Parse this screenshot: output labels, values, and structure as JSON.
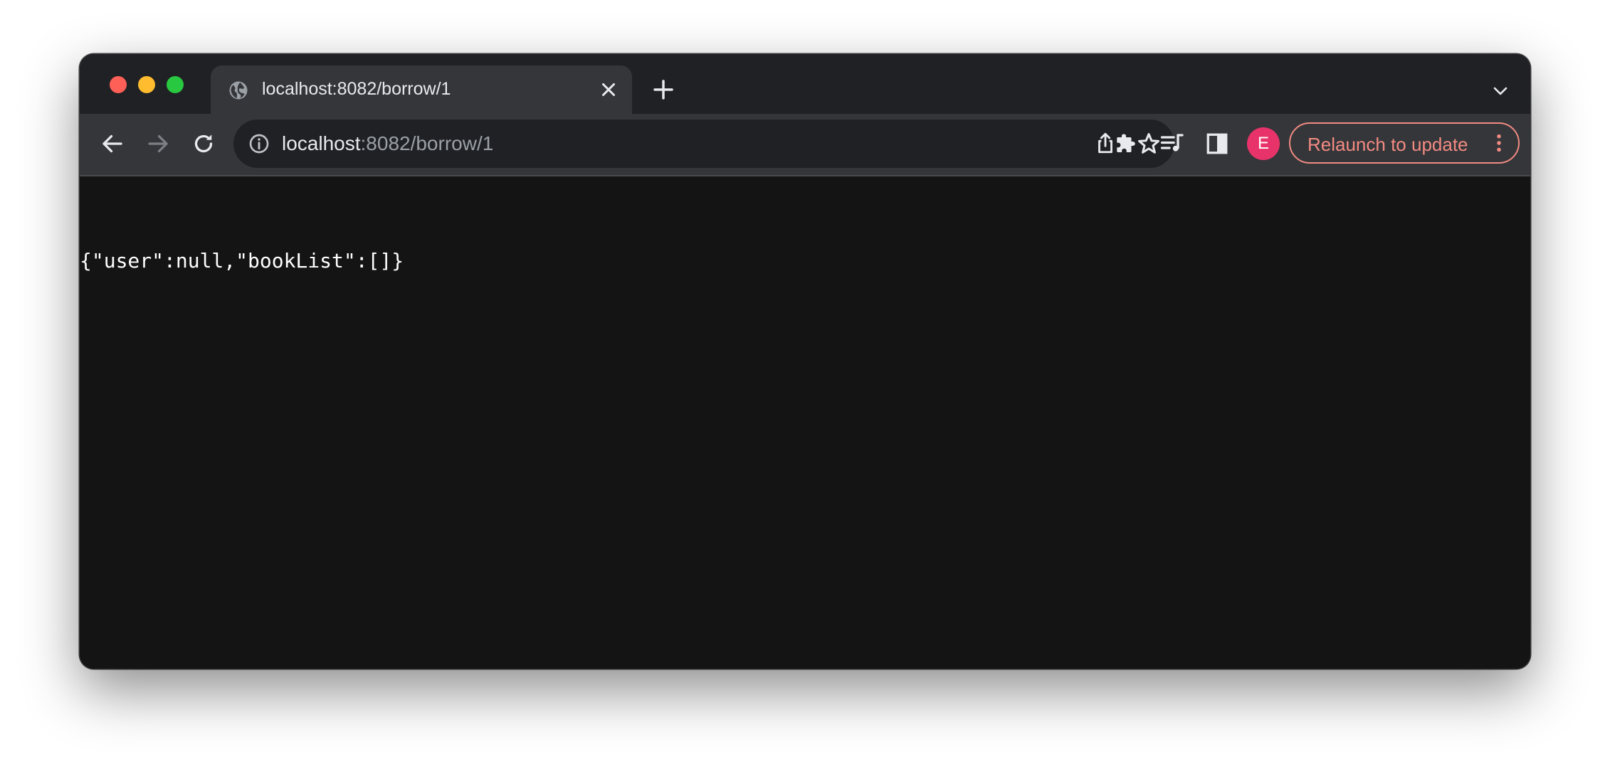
{
  "browser": {
    "tab": {
      "title": "localhost:8082/borrow/1",
      "favicon": "globe-icon"
    },
    "address_bar": {
      "host": "localhost",
      "path": ":8082/borrow/1"
    },
    "profile_initial": "E",
    "relaunch_label": "Relaunch to update",
    "colors": {
      "close": "#fe5f57",
      "minimize": "#febc2e",
      "maximize": "#28c840",
      "avatar": "#e8336a",
      "relaunch_accent": "#f28b82"
    },
    "icons": {
      "back": "arrow-left-icon",
      "forward": "arrow-right-icon",
      "reload": "reload-icon",
      "site_info": "info-icon",
      "share": "share-icon",
      "bookmark": "star-icon",
      "extensions": "puzzle-icon",
      "reading_list": "media-queue-icon",
      "side_panel": "side-panel-icon",
      "more": "kebab-menu-icon"
    }
  },
  "page": {
    "body_text": "{\"user\":null,\"bookList\":[]}"
  }
}
